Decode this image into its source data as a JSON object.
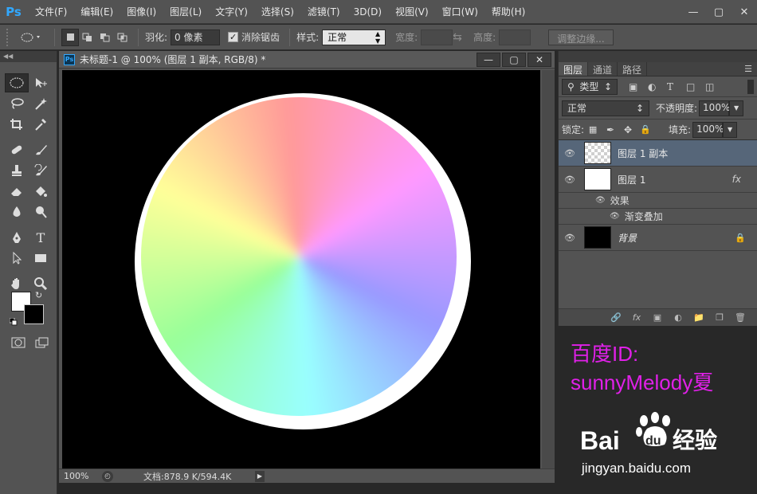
{
  "app": {
    "logo": "Ps"
  },
  "menu": [
    "文件(F)",
    "编辑(E)",
    "图像(I)",
    "图层(L)",
    "文字(Y)",
    "选择(S)",
    "滤镜(T)",
    "3D(D)",
    "视图(V)",
    "窗口(W)",
    "帮助(H)"
  ],
  "options": {
    "feather_label": "羽化:",
    "feather_value": "0 像素",
    "antialias_label": "消除锯齿",
    "antialias_checked": true,
    "style_label": "样式:",
    "style_value": "正常",
    "width_label": "宽度:",
    "height_label": "高度:",
    "refine_edge_label": "调整边缘..."
  },
  "document": {
    "icon": "Ps",
    "title": "未标题-1 @ 100% (图层 1 副本, RGB/8) *",
    "zoom": "100%",
    "doc_info": "文档:878.9 K/594.4K",
    "background_color": "#000000"
  },
  "colors": {
    "foreground": "#ffffff",
    "background": "#000000",
    "accent": "#31a8ff",
    "watermark": "#e020e8"
  },
  "layers_panel": {
    "tabs": [
      "图层",
      "通道",
      "路径"
    ],
    "active_tab": "图层",
    "filter_kind": "类型",
    "blend_mode": "正常",
    "opacity_label": "不透明度:",
    "opacity_value": "100%",
    "lock_label": "锁定:",
    "fill_label": "填充:",
    "fill_value": "100%",
    "layers": [
      {
        "name": "图层 1 副本",
        "selected": true,
        "thumb": "checker"
      },
      {
        "name": "图层 1",
        "selected": false,
        "thumb": "white",
        "fx": "fx"
      },
      {
        "name": "背景",
        "selected": false,
        "thumb": "black",
        "locked": true
      }
    ],
    "effects_label": "效果",
    "effect_item": "渐变叠加"
  },
  "watermark": {
    "line1": "百度ID:",
    "line2": "sunnyMelody夏",
    "baidu_brand_1": "Bai",
    "baidu_brand_2": "du",
    "baidu_cn": "经验",
    "url": "jingyan.baidu.com"
  }
}
